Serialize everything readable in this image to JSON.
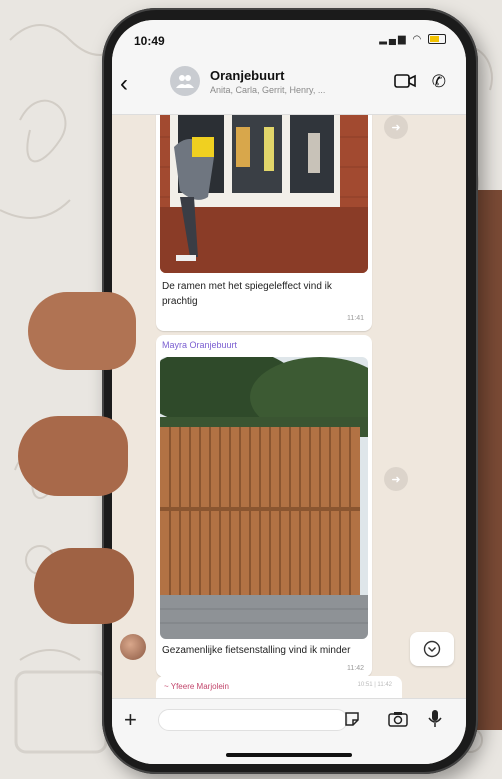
{
  "status_bar": {
    "time": "10:49"
  },
  "header": {
    "back_icon": "chevron-left-icon",
    "group_name": "Oranjebuurt",
    "members": "Anita, Carla, Gerrit, Henry, ...",
    "video_icon": "video-camera-icon",
    "call_icon": "phone-icon"
  },
  "messages": [
    {
      "type": "image",
      "caption": "De ramen met het spiegeleffect vind ik prachtig",
      "time": "11:41"
    },
    {
      "type": "image",
      "sender": "Mayra Oranjebuurt",
      "caption": "Gezamenlijke fietsenstalling vind ik minder",
      "time": "11:42"
    }
  ],
  "reply_preview": {
    "label": "~ Yfeere  Marjolein",
    "time": "10:51 | 11:42"
  },
  "input_bar": {
    "plus_icon": "plus-icon",
    "placeholder": "",
    "sticker_icon": "sticker-icon",
    "camera_icon": "camera-icon",
    "mic_icon": "microphone-icon"
  },
  "colors": {
    "chat_background": "#efe7dd",
    "sender_name": "#7b5fd1",
    "reply_name": "#c2456b"
  }
}
